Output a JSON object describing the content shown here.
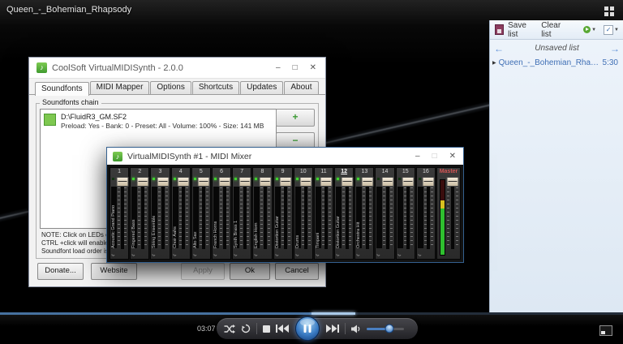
{
  "overlay": {
    "now_playing_title": "Queen_-_Bohemian_Rhapsody"
  },
  "colors": {
    "accent_blue": "#4a7fc1",
    "led_green": "#3fd12e",
    "soundfont_green": "#7ec850",
    "meter_green": "#2fbf2f",
    "meter_yellow": "#d8c020",
    "meter_red": "#3a0d0d",
    "playlist_link": "#3f6fb5"
  },
  "coolsoft_window": {
    "title": "CoolSoft VirtualMIDISynth - 2.0.0",
    "controls": {
      "minimize": "–",
      "maximize": "□",
      "close": "✕"
    },
    "tabs": [
      "Soundfonts",
      "MIDI Mapper",
      "Options",
      "Shortcuts",
      "Updates",
      "About"
    ],
    "active_tab_index": 0,
    "group_label": "Soundfonts chain",
    "soundfont_item": {
      "path": "D:\\FluidR3_GM.SF2",
      "details": "Preload: Yes - Bank: 0 - Preset: All - Volume: 100% - Size: 141 MB"
    },
    "list_buttons": [
      {
        "name": "add",
        "glyph": "+"
      },
      {
        "name": "remove",
        "glyph": "−"
      },
      {
        "name": "edit",
        "glyph": "✎"
      }
    ],
    "note_lines": [
      "NOTE: Click on LEDs or press 1..0 keys",
      "CTRL +click will enable/disable all",
      "Soundfont load order is top to bottom"
    ],
    "footer_buttons": {
      "donate": "Donate...",
      "website": "Website",
      "apply": "Apply",
      "ok": "Ok",
      "cancel": "Cancel"
    }
  },
  "mixer_window": {
    "title": "VirtualMIDISynth #1 - MIDI Mixer",
    "controls": {
      "minimize": "–",
      "maximize": "□",
      "close": "✕"
    },
    "channels": [
      {
        "number": "1",
        "label": "Acoustic Grand Piano",
        "led": false,
        "active": false
      },
      {
        "number": "2",
        "label": "Fingered Bass",
        "led": true,
        "active": false
      },
      {
        "number": "3",
        "label": "String Ensemble",
        "led": true,
        "active": false
      },
      {
        "number": "4",
        "label": "Choir Aahs",
        "led": true,
        "active": false
      },
      {
        "number": "5",
        "label": "Alto Sax",
        "led": true,
        "active": false
      },
      {
        "number": "6",
        "label": "French Horns",
        "led": true,
        "active": false
      },
      {
        "number": "7",
        "label": "Synth Brass 1",
        "led": true,
        "active": false
      },
      {
        "number": "8",
        "label": "English Horn",
        "led": true,
        "active": false
      },
      {
        "number": "9",
        "label": "Distortion Guitar",
        "led": true,
        "active": false
      },
      {
        "number": "10",
        "label": "Drums",
        "led": true,
        "active": false
      },
      {
        "number": "11",
        "label": "Timpani",
        "led": true,
        "active": false
      },
      {
        "number": "12",
        "label": "Distortion Guitar",
        "led": true,
        "active": true
      },
      {
        "number": "13",
        "label": "Orchestra Hit",
        "led": true,
        "active": false
      },
      {
        "number": "14",
        "label": "",
        "led": false,
        "active": false
      },
      {
        "number": "15",
        "label": "",
        "led": false,
        "active": false
      },
      {
        "number": "16",
        "label": "",
        "led": false,
        "active": false
      }
    ],
    "master": {
      "label": "Master",
      "meter_green_pct": 62,
      "meter_yellow_pct": 11
    }
  },
  "playlist_pane": {
    "toolbar": {
      "save_list": "Save list",
      "clear_list": "Clear list"
    },
    "list_title": "Unsaved list",
    "items": [
      {
        "title": "Queen_-_Bohemian_Rhapsody",
        "duration": "5:30"
      }
    ]
  },
  "transport_bar": {
    "elapsed_time": "03:07",
    "progress_pct": 57,
    "volume_pct": 60
  }
}
